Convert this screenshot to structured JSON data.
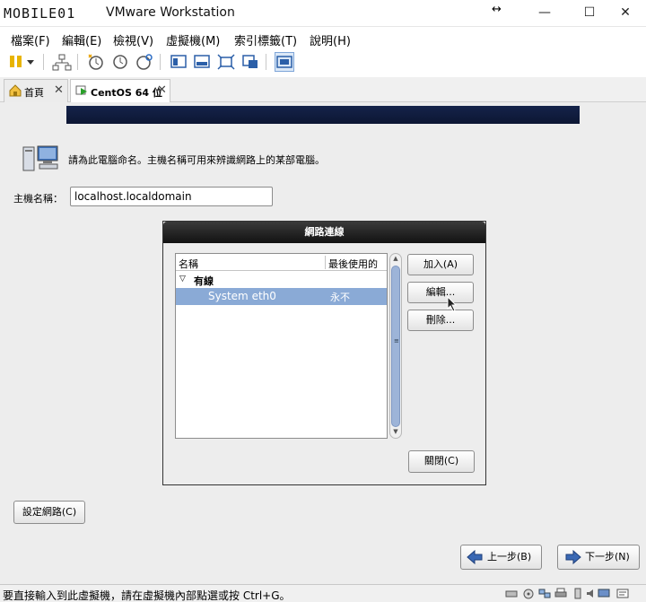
{
  "window": {
    "logo_text": "MOBILE01",
    "title": "VMware Workstation",
    "controls": {
      "restore_arrow": "↔",
      "minimize": "—",
      "maximize": "☐",
      "close": "✕"
    }
  },
  "menu": {
    "items": [
      "檔案(F)",
      "編輯(E)",
      "檢視(V)",
      "虛擬機(M)",
      "索引標籤(T)",
      "說明(H)"
    ]
  },
  "toolbar": {
    "icons": [
      "pause-icon",
      "dropdown-icon",
      "network-icon",
      "snapshot-icon",
      "revert-icon",
      "snapshot-manager-icon",
      "console-view-icon",
      "unity-icon",
      "fullscreen-icon",
      "stretch-icon",
      "thumbnail-icon"
    ]
  },
  "tabs": [
    {
      "label": "首頁",
      "close": "✕",
      "active": false
    },
    {
      "label": "CentOS 64 位",
      "close": "✕",
      "active": true
    }
  ],
  "installer": {
    "intro": "請為此電腦命名。主機名稱可用來辨識網路上的某部電腦。",
    "hostname_label": "主機名稱：",
    "hostname_value": "localhost.localdomain",
    "configure_network_button": "設定網路(C)",
    "back_button": "上一步(B)",
    "next_button": "下一步(N)"
  },
  "dialog": {
    "title": "網路連線",
    "columns": [
      "名稱",
      "最後使用的"
    ],
    "group": {
      "expander": "▽",
      "label": "有線"
    },
    "rows": [
      {
        "name": "System eth0",
        "last_used": "永不",
        "selected": true
      }
    ],
    "scrollbar": {
      "up": "▲",
      "down": "▼",
      "grip": "≡"
    },
    "buttons": {
      "add": "加入(A)",
      "edit": "編輯...",
      "delete": "刪除...",
      "close": "關閉(C)"
    }
  },
  "status": {
    "text": "要直接輸入到此虛擬機，請在虛擬機內部點選或按 Ctrl+G。"
  },
  "colors": {
    "banner": "#0c1633",
    "selection": "#8aaad6",
    "dialog_title": "#1c1c1c",
    "guest_background": "#ededed"
  }
}
